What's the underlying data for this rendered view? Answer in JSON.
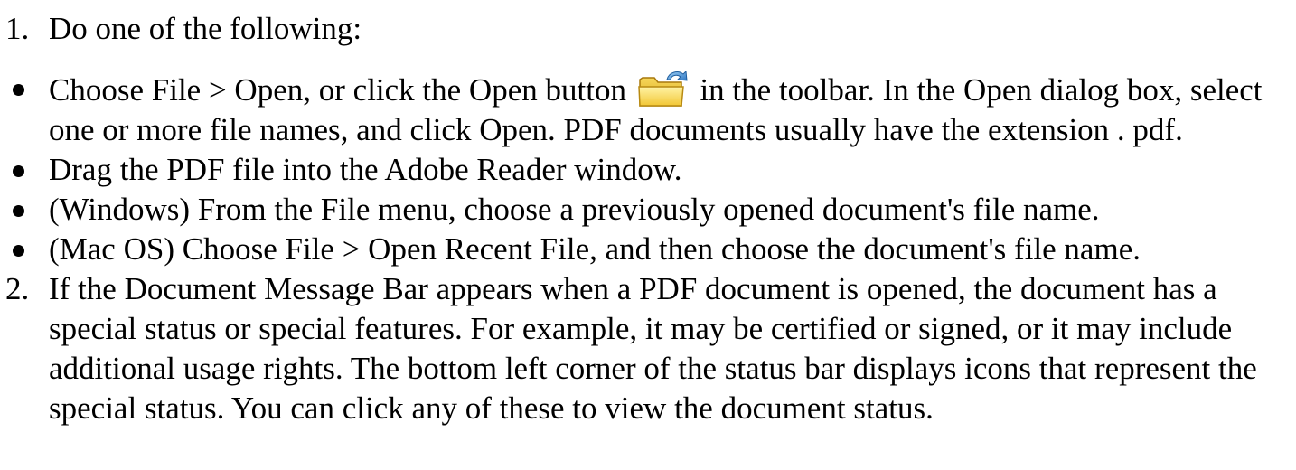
{
  "steps": [
    {
      "number": "1.",
      "text": "Do one of the following:"
    },
    {
      "number": "2.",
      "text": "If the Document Message Bar appears when a PDF document is opened, the document has a special status or special features. For example, it may be certified or signed, or it may include additional usage rights. The bottom left corner of the status bar displays icons that represent the special status. You can click any of these to view the document status."
    }
  ],
  "bullets": [
    {
      "before_icon": "Choose File > Open, or click the Open button",
      "icon": "open-folder-icon",
      "after_icon": " in the toolbar. In the Open dialog box, select one or more file names, and click Open. PDF documents usually have the extension . pdf."
    },
    {
      "text": "Drag the PDF file into the Adobe Reader window."
    },
    {
      "text": "(Windows) From the File menu, choose a previously opened document's file name."
    },
    {
      "text": "(Mac OS) Choose File > Open Recent File, and then choose the document's file name."
    }
  ]
}
